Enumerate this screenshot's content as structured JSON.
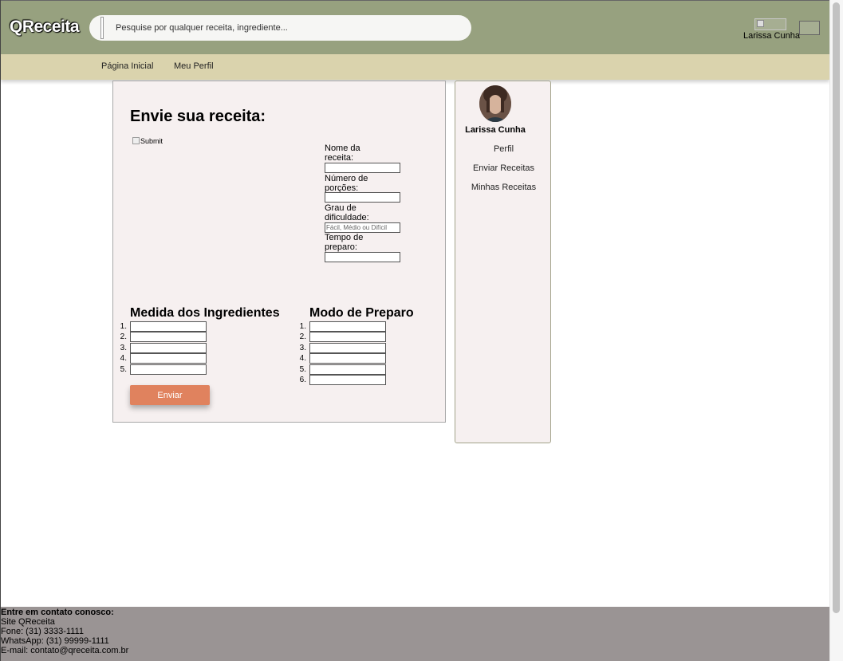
{
  "header": {
    "logo": "QReceita",
    "search_placeholder": "Pesquise por qualquer receita, ingrediente...",
    "user_name": "Larissa Cunha"
  },
  "nav": {
    "items": [
      "Página Inicial",
      "Meu Perfil"
    ]
  },
  "form": {
    "title": "Envie sua receita:",
    "image_alt": "Submit",
    "fields": [
      {
        "label": "Nome da receita:",
        "value": "",
        "placeholder": ""
      },
      {
        "label": "Número de porções:",
        "value": "",
        "placeholder": ""
      },
      {
        "label": "Grau de dificuldade:",
        "value": "",
        "placeholder": "Fácil, Médio ou Difícil"
      },
      {
        "label": "Tempo de preparo:",
        "value": "",
        "placeholder": ""
      }
    ],
    "ingredients_title": "Medida dos Ingredientes",
    "ingredients_numbers": [
      "1.",
      "2.",
      "3.",
      "4.",
      "5."
    ],
    "steps_title": "Modo de Preparo",
    "steps_numbers": [
      "1.",
      "2.",
      "3.",
      "4.",
      "5.",
      "6."
    ],
    "submit_label": "Enviar"
  },
  "sidebar": {
    "name": "Larissa Cunha",
    "links": [
      "Perfil",
      "Enviar Receitas",
      "Minhas Receitas"
    ]
  },
  "footer": {
    "heading": "Entre em contato conosco:",
    "lines": [
      "Site QReceita",
      "Fone: (31) 3333-1111",
      "WhatsApp: (31) 99999-1111",
      "E-mail: contato@qreceita.com.br"
    ]
  },
  "colors": {
    "header_bg": "#97a17f",
    "nav_bg": "#dad3ad",
    "card_bg": "#f6f0f0",
    "button": "#e0825e",
    "footer_bg": "#9a9494"
  }
}
